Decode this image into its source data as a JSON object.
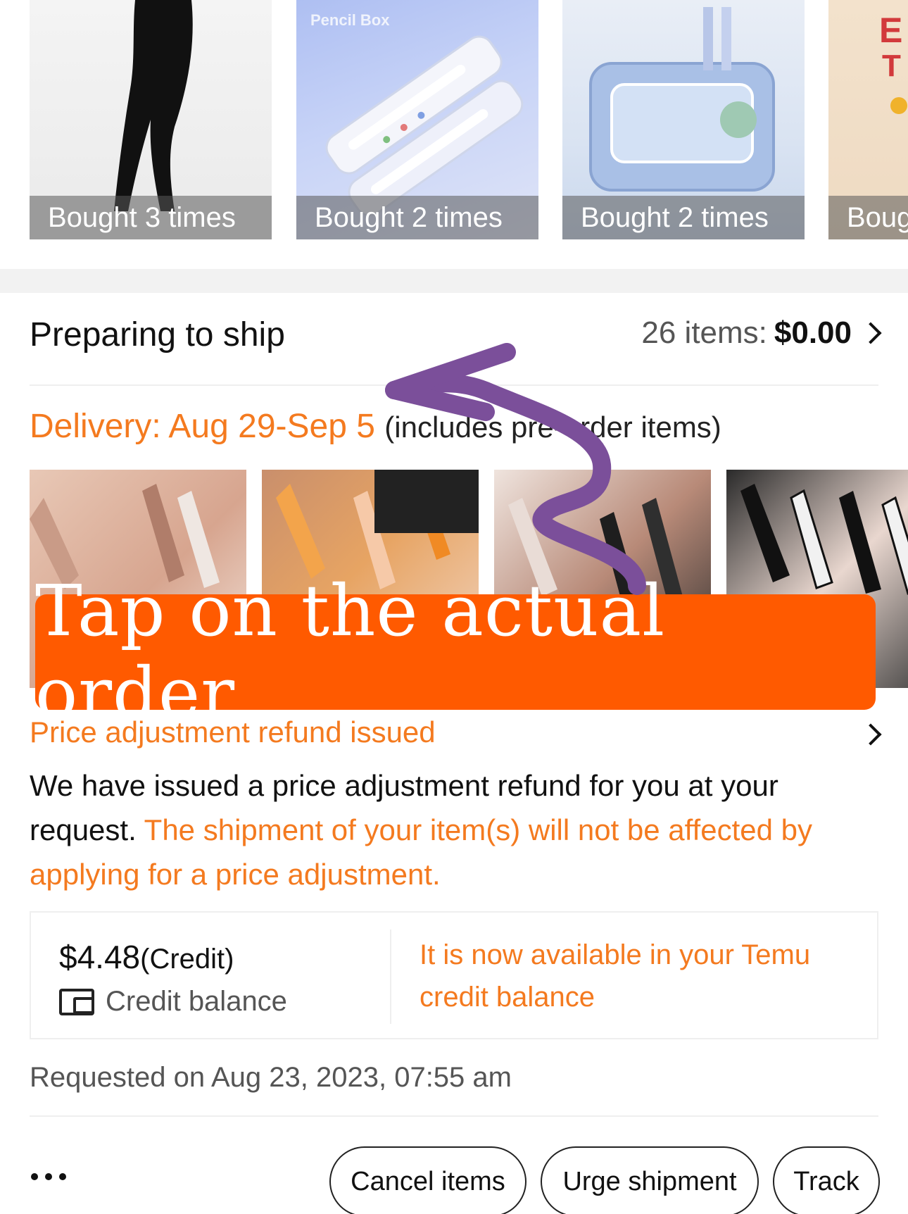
{
  "recently_bought": [
    {
      "caption": "Bought 3 times",
      "image": "black leggings"
    },
    {
      "caption": "Bought 2 times",
      "image": "pencil box",
      "image_text": "Pencil Box"
    },
    {
      "caption": "Bought 2 times",
      "image": "blue pencil case"
    },
    {
      "caption": "Boug",
      "image": "graphic t-shirt"
    }
  ],
  "order": {
    "status_title": "Preparing to ship",
    "items_count": "26 items:",
    "total": "$0.00",
    "delivery_label": "Delivery: Aug 29-Sep 5",
    "delivery_note": "(includes pre-order items)",
    "images": [
      "press-on nails 1",
      "press-on nails 2",
      "press-on nails 3",
      "press-on nails 4"
    ]
  },
  "overlay": {
    "banner_text": "Tap on the actual order",
    "banner_color": "#ff5a00",
    "arrow_color": "#7b4f9a"
  },
  "price_adjustment": {
    "title": "Price adjustment refund issued",
    "body_plain": "We have issued a price adjustment refund for you at your request. ",
    "body_highlight": "The shipment of your item(s) will not be affected by applying for a price adjustment.",
    "credit_amount": "$4.48",
    "credit_suffix": "(Credit)",
    "credit_label": "Credit balance",
    "credit_note": "It is now available in your Temu credit balance",
    "requested_on": "Requested on Aug 23, 2023, 07:55 am"
  },
  "actions": {
    "cancel_label": "Cancel items",
    "urge_label": "Urge shipment",
    "track_label": "Track"
  },
  "colors": {
    "accent_orange": "#f47a1f",
    "text_dark": "#111111",
    "text_gray": "#555555"
  }
}
